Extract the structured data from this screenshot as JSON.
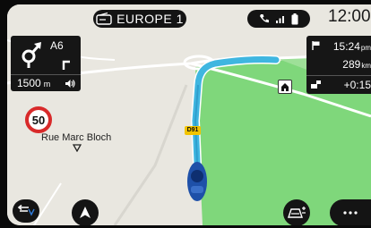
{
  "header": {
    "radio_station": "EUROPE 1",
    "clock": "12:00",
    "radio_icon": "radio-icon",
    "status_icons": [
      "phone-icon",
      "signal-icon",
      "battery-icon"
    ]
  },
  "guidance": {
    "road": "A6",
    "distance": "1500",
    "distance_unit": "m",
    "maneuver_icon": "roundabout-exit-icon",
    "lane_icon": "turn-right-icon",
    "volume_icon": "volume-icon"
  },
  "trip": {
    "arrival_time": "15:24",
    "arrival_suffix": "pm",
    "remaining_distance": "289",
    "remaining_unit": "km",
    "delay": "+0:15",
    "flag_icon": "destination-flag-icon",
    "traffic_icon": "traffic-icon"
  },
  "map": {
    "speed_limit": "50",
    "street_name": "Rue Marc Bloch",
    "road_shield": "D91",
    "home_icon": "home-icon",
    "car_icon": "car-icon"
  },
  "colors": {
    "route": "#3fb6e0",
    "green_area": "#7ed77a",
    "map_bg": "#e8e6df",
    "panel": "#161616"
  },
  "buttons": {
    "back_icon": "back-icon",
    "navigation_icon": "navigation-arrow-icon",
    "map_views_icon": "map-views-icon",
    "more_icon": "more-icon"
  }
}
